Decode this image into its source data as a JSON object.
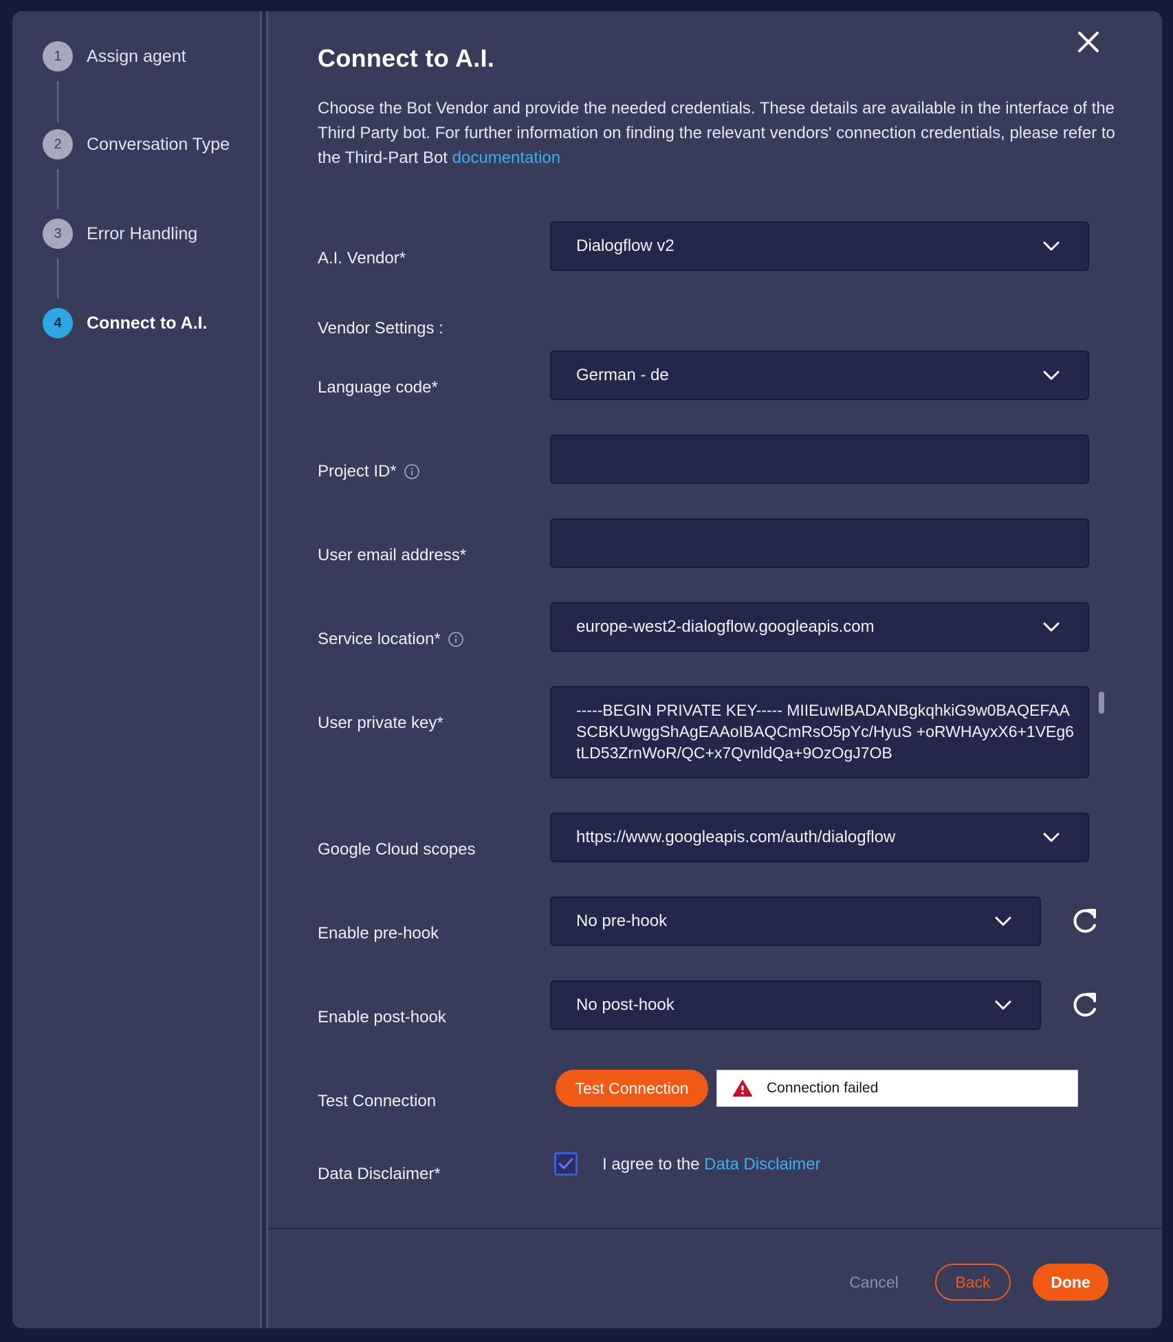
{
  "stepper": {
    "steps": [
      {
        "number": "1",
        "label": "Assign agent"
      },
      {
        "number": "2",
        "label": "Conversation Type"
      },
      {
        "number": "3",
        "label": "Error Handling"
      },
      {
        "number": "4",
        "label": "Connect to A.I."
      }
    ]
  },
  "header": {
    "title": "Connect to A.I.",
    "description": "Choose the Bot Vendor and provide the needed credentials. These details are available in the interface of the Third Party bot. For further information on finding the relevant vendors' connection credentials, please refer to the Third-Part Bot ",
    "doc_link": "documentation"
  },
  "form": {
    "vendor": {
      "label": "A.I. Vendor*",
      "value": "Dialogflow v2"
    },
    "vendor_settings_label": "Vendor Settings :",
    "language": {
      "label": "Language code*",
      "value": "German - de"
    },
    "project_id": {
      "label": "Project ID*",
      "value": ""
    },
    "email": {
      "label": "User email address*",
      "value": ""
    },
    "service_location": {
      "label": "Service location*",
      "value": "europe-west2-dialogflow.googleapis.com"
    },
    "private_key": {
      "label": "User private key*",
      "value": "-----BEGIN PRIVATE KEY----- MIIEuwIBADANBgkqhkiG9w0BAQEFAASCBKUwggShAgEAAoIBAQCmRsO5pYc/HyuS +oRWHAyxX6+1VEg6tLD53ZrnWoR/QC+x7QvnldQa+9OzOgJ7OB"
    },
    "scopes": {
      "label": "Google Cloud scopes",
      "value": "https://www.googleapis.com/auth/dialogflow"
    },
    "prehook": {
      "label": "Enable pre-hook",
      "value": "No pre-hook"
    },
    "posthook": {
      "label": "Enable post-hook",
      "value": "No post-hook"
    },
    "test": {
      "label": "Test Connection",
      "button": "Test Connection",
      "status": "Connection failed"
    },
    "disclaimer": {
      "label": "Data Disclaimer*",
      "text": "I agree to the ",
      "link": "Data Disclaimer",
      "checked": true
    }
  },
  "footer": {
    "cancel": "Cancel",
    "back": "Back",
    "done": "Done"
  },
  "colors": {
    "accent": "#f05a15",
    "link": "#3cb0ee",
    "active_step": "#2ea8e5",
    "panel": "#383b59",
    "input": "#24274a"
  },
  "icons": [
    "close-icon",
    "chevron-down-icon",
    "info-icon",
    "refresh-icon",
    "warning-icon",
    "checkmark-icon"
  ]
}
